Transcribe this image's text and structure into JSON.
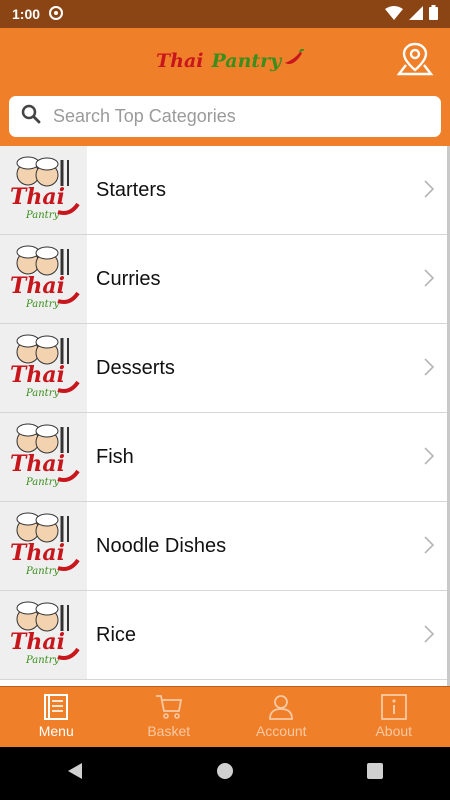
{
  "status_bar": {
    "time": "1:00"
  },
  "header": {
    "brand_word1": "Thai",
    "brand_word2": "Pantry"
  },
  "search": {
    "placeholder": "Search Top Categories"
  },
  "categories": [
    {
      "label": "Starters"
    },
    {
      "label": "Curries"
    },
    {
      "label": "Desserts"
    },
    {
      "label": "Fish"
    },
    {
      "label": "Noodle Dishes"
    },
    {
      "label": "Rice"
    }
  ],
  "tabs": [
    {
      "label": "Menu",
      "icon": "menu-book-icon",
      "active": true
    },
    {
      "label": "Basket",
      "icon": "cart-icon",
      "active": false
    },
    {
      "label": "Account",
      "icon": "person-icon",
      "active": false
    },
    {
      "label": "About",
      "icon": "info-icon",
      "active": false
    }
  ],
  "colors": {
    "primary": "#f07f2a",
    "status_bar": "#8b4413",
    "brand_red": "#c8161d",
    "brand_green": "#3a8f1c"
  }
}
